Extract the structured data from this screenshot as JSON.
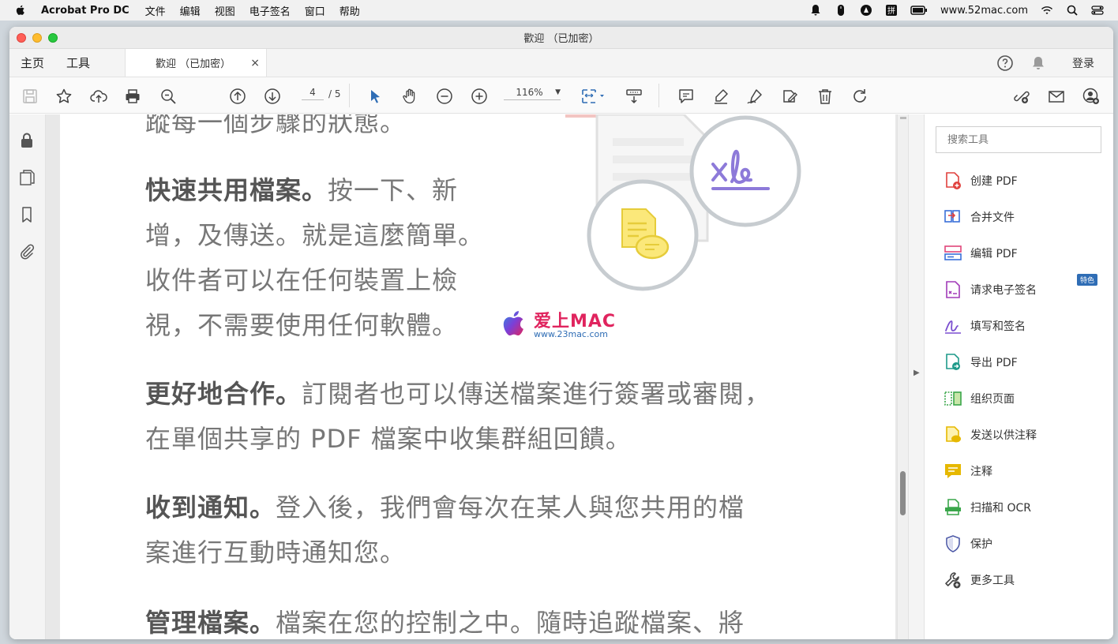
{
  "menubar": {
    "app_name": "Acrobat Pro DC",
    "items": [
      "文件",
      "编辑",
      "视图",
      "电子签名",
      "窗口",
      "帮助"
    ],
    "site": "www.52mac.com"
  },
  "window": {
    "title": "歡迎 （已加密）"
  },
  "tabs": {
    "home": "主页",
    "tools": "工具",
    "doc_tab": "歡迎 （已加密）",
    "close": "×",
    "login": "登录"
  },
  "toolbar": {
    "current_page": "4",
    "total_pages": "/ 5",
    "zoom": "116%"
  },
  "document": {
    "p0": "蹤每一個步驟的狀態。",
    "p1_bold": "快速共用檔案。",
    "p1_line1": "按一下、新",
    "p1_line2": "增，及傳送。就是這麼簡單。",
    "p1_line3": "收件者可以在任何裝置上檢",
    "p1_line4": "視，不需要使用任何軟體。",
    "p2_bold": "更好地合作。",
    "p2_line1": "訂閱者也可以傳送檔案進行簽署或審閱，",
    "p2_line2": "在單個共享的 PDF 檔案中收集群組回饋。",
    "p3_bold": "收到通知。",
    "p3_line1": "登入後，我們會每次在某人與您共用的檔",
    "p3_line2": "案進行互動時通知您。",
    "p4_bold": "管理檔案。",
    "p4_line1": "檔案在您的控制之中。隨時追蹤檔案、將",
    "watermark_title": "爱上MAC",
    "watermark_url": "www.23mac.com"
  },
  "tools_panel": {
    "search_placeholder": "搜索工具",
    "badge": "特色",
    "items": [
      {
        "label": "创建 PDF",
        "color": "#e0413d"
      },
      {
        "label": "合并文件",
        "color": "#3a6fd8"
      },
      {
        "label": "编辑 PDF",
        "color": "#e0457a"
      },
      {
        "label": "请求电子签名",
        "color": "#a23bb8"
      },
      {
        "label": "填写和签名",
        "color": "#7b4fd0"
      },
      {
        "label": "导出 PDF",
        "color": "#1e9a8a"
      },
      {
        "label": "组织页面",
        "color": "#3aa64a"
      },
      {
        "label": "发送以供注释",
        "color": "#e6b800"
      },
      {
        "label": "注释",
        "color": "#e6b800"
      },
      {
        "label": "扫描和 OCR",
        "color": "#3aa64a"
      },
      {
        "label": "保护",
        "color": "#4f5ba8"
      },
      {
        "label": "更多工具",
        "color": "#444444"
      }
    ]
  }
}
